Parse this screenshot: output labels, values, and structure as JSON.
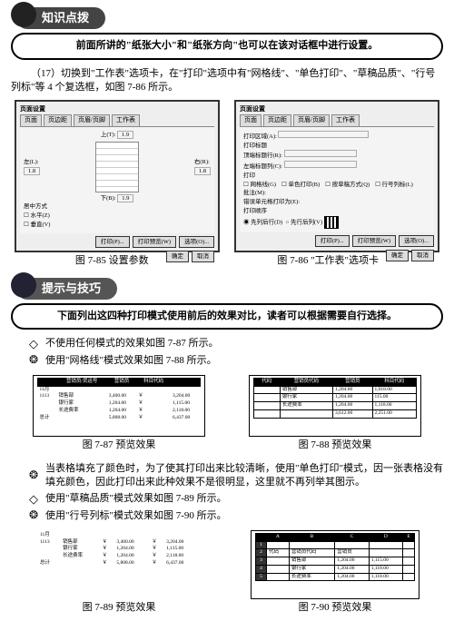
{
  "banner1": {
    "title": "知识点拨"
  },
  "pill1": "前面所讲的\"纸张大小\"和\"纸张方向\"也可以在该对话框中进行设置。",
  "step17": "（17）切换到\"工作表\"选项卡，在\"打印\"选项中有\"网格线\"、\"单色打印\"、\"草稿品质\"、\"行号列标\"等 4 个复选框，如图 7-86 所示。",
  "dialogL": {
    "title": "页面设置",
    "tabs": [
      "页面",
      "页边距",
      "页眉/页脚",
      "工作表"
    ],
    "margins": {
      "top": "上(T):",
      "tv": "1.9",
      "bottom": "下(B):",
      "bv": "1.9",
      "left": "左(L):",
      "lv": "1.8",
      "right": "右(R):",
      "rv": "1.8"
    },
    "center": "居中方式",
    "chkH": "水平(Z)",
    "chkV": "垂直(V)",
    "btns": [
      "打印(P)...",
      "打印预览(W)",
      "选项(O)...",
      "确定",
      "取消"
    ]
  },
  "dialogR": {
    "title": "页面设置",
    "tabs": [
      "页面",
      "页边距",
      "页眉/页脚",
      "工作表"
    ],
    "area": "打印区域(A):",
    "titles": "打印标题",
    "rowT": "顶端标题行(R):",
    "colT": "左端标题列(C):",
    "printSec": "打印",
    "o1": "网格线(G)",
    "o2": "单色打印(B)",
    "o3": "按草稿方式(Q)",
    "o4": "行号列标(L)",
    "o5": "批注(M):",
    "o6": "错误单元格打印为(E):",
    "orderSec": "打印顺序",
    "ord1": "先列后行(D)",
    "ord2": "先行后列(V)",
    "btns": [
      "打印(P)...",
      "打印预览(W)",
      "选项(O)...",
      "确定",
      "取消"
    ]
  },
  "caption85": "图 7-85  设置参数",
  "caption86": "图 7-86 \"工作表\"选项卡",
  "banner2": {
    "title": "提示与技巧"
  },
  "pill2": "下面列出这四种打印模式使用前后的效果对比，读者可以根据需要自行选择。",
  "bullets1": [
    {
      "sym": "dia",
      "text": "不使用任何模式的效果如图 7-87 所示。"
    },
    {
      "sym": "circ",
      "text": "使用\"网格线\"模式效果如图 7-88 所示。"
    }
  ],
  "chart_data": [
    {
      "type": "table",
      "figure": "7-87",
      "columns": [
        "",
        "营销员/货运号",
        "营销员",
        "科目代码",
        ""
      ],
      "rows": [
        [
          "11月",
          "",
          " ",
          " ",
          " "
        ],
        [
          "1113",
          "销售部",
          "3,400.00",
          "￥",
          "3,204.00"
        ],
        [
          "",
          "银行家",
          "1,204.00",
          "￥",
          "1,115.00"
        ],
        [
          "",
          "长途费率",
          "1,204.00",
          "￥",
          "2,118.00"
        ],
        [
          "总计",
          "",
          "5,808.00",
          "￥",
          "6,437.00"
        ]
      ]
    },
    {
      "type": "table",
      "figure": "7-88",
      "columns": [
        "代码",
        "营销员代码",
        "营销员",
        "科目代码"
      ],
      "rows": [
        [
          "",
          "销售部",
          "1,204.00",
          "1,018.00"
        ],
        [
          "",
          "银行家",
          "1,204.00",
          "115.00"
        ],
        [
          "",
          "长途费率",
          "1,204.00",
          "1,118.00"
        ],
        [
          "",
          "",
          "3,612.00",
          "2,251.00"
        ]
      ]
    },
    {
      "type": "table",
      "figure": "7-89",
      "columns": [
        "",
        "",
        "",
        "",
        "",
        ""
      ],
      "rows": [
        [
          "11月",
          "",
          "",
          "",
          "",
          ""
        ],
        [
          "1113",
          "销售部",
          "￥",
          "3,400.00",
          "￥",
          "3,204.00"
        ],
        [
          "",
          "银行家",
          "￥",
          "1,204.00",
          "￥",
          "1,115.00"
        ],
        [
          "",
          "长途费率",
          "￥",
          "1,204.00",
          "￥",
          "2,118.00"
        ],
        [
          "总计",
          "",
          "￥",
          "5,808.00",
          "￥",
          "6,437.00"
        ]
      ]
    },
    {
      "type": "table",
      "figure": "7-90",
      "columns": [
        "",
        "A",
        "B",
        "C",
        "D",
        "E"
      ],
      "rows": [
        [
          "1",
          "",
          "",
          "",
          "",
          ""
        ],
        [
          "2",
          "代码",
          "营销员代码",
          "营销员",
          "",
          ""
        ],
        [
          "3",
          "",
          "销售部",
          "1,204.00",
          "1,115.00",
          ""
        ],
        [
          "4",
          "",
          "银行家",
          "1,204.00",
          "1,118.00",
          ""
        ],
        [
          "5",
          "",
          "长途费率",
          "1,204.00",
          "1,118.00",
          ""
        ]
      ]
    }
  ],
  "caption87": "图 7-87  预览效果",
  "caption88": "图 7-88  预览效果",
  "paraColor": "当表格填充了颜色时，为了使其打印出来比较清晰，使用\"单色打印\"模式，因一张表格没有填充颜色，因此打印出来此种效果不是很明显，这里就不再列举其图示。",
  "bullets2": [
    {
      "sym": "dia",
      "text": "使用\"草稿品质\"模式效果如图 7-89 所示。"
    },
    {
      "sym": "circ",
      "text": "使用\"行号列标\"模式效果如图 7-90 所示。"
    }
  ],
  "caption89": "图 7-89  预览效果",
  "caption90": "图 7-90  预览效果"
}
